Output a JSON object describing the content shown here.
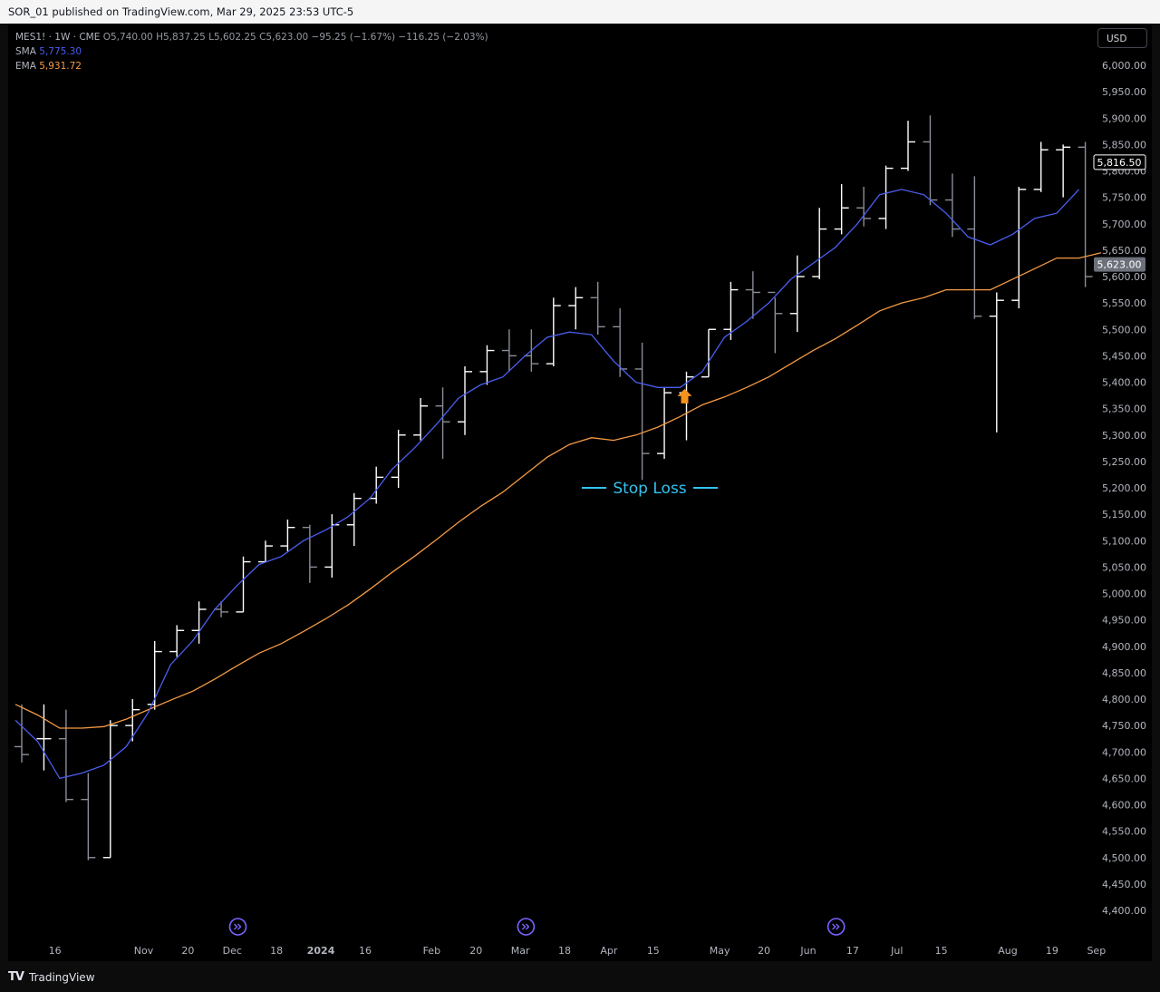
{
  "header": {
    "published_line": "SOR_01 published on TradingView.com, Mar 29, 2025 23:53 UTC-5"
  },
  "legend": {
    "symbol": "MES1! · 1W · CME",
    "ohlc": {
      "o": "O",
      "o_val": "5,740.00",
      "h": "H",
      "h_val": "5,837.25",
      "l": "L",
      "l_val": "5,602.25",
      "c": "C",
      "c_val": "5,623.00",
      "change": "−95.25 (−1.67%)",
      "change2": "−116.25 (−2.03%)"
    },
    "sma_label": "SMA",
    "sma_value": "5,775.30",
    "ema_label": "EMA",
    "ema_value": "5,931.72"
  },
  "currency_button": "USD",
  "annotation": {
    "text": "Stop Loss"
  },
  "footer": {
    "brand": "TradingView",
    "logo": "TV"
  },
  "colors": {
    "sma": "#4a5ef0",
    "ema": "#f59a45",
    "annotation": "#33c3ef",
    "arrow": "#f5931f",
    "event": "#7b61ff"
  },
  "chart_data": {
    "type": "ohlc-bar",
    "ylim": [
      4400,
      6000
    ],
    "y_ticks": [
      6000,
      5950,
      5900,
      5850,
      5800,
      5750,
      5700,
      5650,
      5600,
      5550,
      5500,
      5450,
      5400,
      5350,
      5300,
      5250,
      5200,
      5150,
      5100,
      5050,
      5000,
      4950,
      4900,
      4850,
      4800,
      4750,
      4700,
      4650,
      4600,
      4550,
      4500,
      4450,
      4400
    ],
    "y_tick_labels": [
      "6,000.00",
      "5,950.00",
      "5,900.00",
      "5,850.00",
      "5,800.00",
      "5,750.00",
      "5,700.00",
      "5,650.00",
      "5,600.00",
      "5,550.00",
      "5,500.00",
      "5,450.00",
      "5,400.00",
      "5,350.00",
      "5,300.00",
      "5,250.00",
      "5,200.00",
      "5,150.00",
      "5,100.00",
      "5,050.00",
      "5,000.00",
      "4,950.00",
      "4,900.00",
      "4,850.00",
      "4,800.00",
      "4,750.00",
      "4,700.00",
      "4,650.00",
      "4,600.00",
      "4,550.00",
      "4,500.00",
      "4,450.00",
      "4,400.00"
    ],
    "x_ticks": [
      {
        "bar": 1.5,
        "label": "16"
      },
      {
        "bar": 5.5,
        "label": "Nov"
      },
      {
        "bar": 7.5,
        "label": "20"
      },
      {
        "bar": 9.5,
        "label": "Dec"
      },
      {
        "bar": 11.5,
        "label": "18"
      },
      {
        "bar": 13.5,
        "label": "2024"
      },
      {
        "bar": 15.5,
        "label": "16"
      },
      {
        "bar": 18.5,
        "label": "Feb"
      },
      {
        "bar": 20.5,
        "label": "20"
      },
      {
        "bar": 22.5,
        "label": "Mar"
      },
      {
        "bar": 24.5,
        "label": "18"
      },
      {
        "bar": 26.5,
        "label": "Apr"
      },
      {
        "bar": 28.5,
        "label": "15"
      },
      {
        "bar": 31.5,
        "label": "May"
      },
      {
        "bar": 33.5,
        "label": "20"
      },
      {
        "bar": 35.5,
        "label": "Jun"
      },
      {
        "bar": 37.5,
        "label": "17"
      },
      {
        "bar": 39.5,
        "label": "Jul"
      },
      {
        "bar": 41.5,
        "label": "15"
      },
      {
        "bar": 44.5,
        "label": "Aug"
      },
      {
        "bar": 46.5,
        "label": "19"
      },
      {
        "bar": 48.5,
        "label": "Sep"
      }
    ],
    "bars": [
      {
        "o": 4710,
        "h": 4790,
        "l": 4680,
        "c": 4695
      },
      {
        "o": 4725,
        "h": 4790,
        "l": 4665,
        "c": 4725
      },
      {
        "o": 4725,
        "h": 4780,
        "l": 4605,
        "c": 4610
      },
      {
        "o": 4610,
        "h": 4660,
        "l": 4495,
        "c": 4500
      },
      {
        "o": 4500,
        "h": 4760,
        "l": 4500,
        "c": 4750
      },
      {
        "o": 4750,
        "h": 4800,
        "l": 4720,
        "c": 4780
      },
      {
        "o": 4790,
        "h": 4910,
        "l": 4780,
        "c": 4890
      },
      {
        "o": 4890,
        "h": 4940,
        "l": 4880,
        "c": 4930
      },
      {
        "o": 4930,
        "h": 4985,
        "l": 4905,
        "c": 4970
      },
      {
        "o": 4970,
        "h": 4985,
        "l": 4955,
        "c": 4965
      },
      {
        "o": 4965,
        "h": 5070,
        "l": 4965,
        "c": 5060
      },
      {
        "o": 5060,
        "h": 5100,
        "l": 5060,
        "c": 5090
      },
      {
        "o": 5090,
        "h": 5140,
        "l": 5080,
        "c": 5125
      },
      {
        "o": 5125,
        "h": 5130,
        "l": 5020,
        "c": 5050
      },
      {
        "o": 5050,
        "h": 5150,
        "l": 5030,
        "c": 5130
      },
      {
        "o": 5130,
        "h": 5190,
        "l": 5090,
        "c": 5180
      },
      {
        "o": 5180,
        "h": 5240,
        "l": 5170,
        "c": 5220
      },
      {
        "o": 5220,
        "h": 5310,
        "l": 5200,
        "c": 5300
      },
      {
        "o": 5300,
        "h": 5370,
        "l": 5290,
        "c": 5355
      },
      {
        "o": 5355,
        "h": 5390,
        "l": 5255,
        "c": 5325
      },
      {
        "o": 5325,
        "h": 5430,
        "l": 5300,
        "c": 5420
      },
      {
        "o": 5420,
        "h": 5470,
        "l": 5395,
        "c": 5460
      },
      {
        "o": 5460,
        "h": 5500,
        "l": 5420,
        "c": 5450
      },
      {
        "o": 5450,
        "h": 5500,
        "l": 5420,
        "c": 5435
      },
      {
        "o": 5435,
        "h": 5560,
        "l": 5430,
        "c": 5545
      },
      {
        "o": 5545,
        "h": 5580,
        "l": 5500,
        "c": 5560
      },
      {
        "o": 5560,
        "h": 5590,
        "l": 5490,
        "c": 5505
      },
      {
        "o": 5505,
        "h": 5540,
        "l": 5410,
        "c": 5425
      },
      {
        "o": 5425,
        "h": 5475,
        "l": 5215,
        "c": 5265
      },
      {
        "o": 5265,
        "h": 5390,
        "l": 5255,
        "c": 5380
      },
      {
        "o": 5380,
        "h": 5420,
        "l": 5290,
        "c": 5410
      },
      {
        "o": 5410,
        "h": 5500,
        "l": 5410,
        "c": 5500
      },
      {
        "o": 5500,
        "h": 5590,
        "l": 5480,
        "c": 5575
      },
      {
        "o": 5575,
        "h": 5610,
        "l": 5520,
        "c": 5570
      },
      {
        "o": 5570,
        "h": 5560,
        "l": 5455,
        "c": 5530
      },
      {
        "o": 5530,
        "h": 5640,
        "l": 5495,
        "c": 5600
      },
      {
        "o": 5600,
        "h": 5730,
        "l": 5595,
        "c": 5690
      },
      {
        "o": 5690,
        "h": 5775,
        "l": 5680,
        "c": 5730
      },
      {
        "o": 5730,
        "h": 5770,
        "l": 5695,
        "c": 5710
      },
      {
        "o": 5710,
        "h": 5810,
        "l": 5690,
        "c": 5805
      },
      {
        "o": 5805,
        "h": 5895,
        "l": 5800,
        "c": 5855
      },
      {
        "o": 5855,
        "h": 5905,
        "l": 5735,
        "c": 5745
      },
      {
        "o": 5745,
        "h": 5795,
        "l": 5675,
        "c": 5690
      },
      {
        "o": 5690,
        "h": 5790,
        "l": 5520,
        "c": 5525
      },
      {
        "o": 5525,
        "h": 5570,
        "l": 5305,
        "c": 5555
      },
      {
        "o": 5555,
        "h": 5770,
        "l": 5540,
        "c": 5765
      },
      {
        "o": 5765,
        "h": 5855,
        "l": 5760,
        "c": 5840
      },
      {
        "o": 5840,
        "h": 5850,
        "l": 5750,
        "c": 5845
      },
      {
        "o": 5845,
        "h": 5855,
        "l": 5580,
        "c": 5600
      }
    ],
    "sma": [
      4760,
      4720,
      4650,
      4660,
      4675,
      4710,
      4775,
      4865,
      4910,
      4970,
      5015,
      5055,
      5070,
      5100,
      5120,
      5145,
      5180,
      5235,
      5275,
      5320,
      5370,
      5395,
      5410,
      5450,
      5485,
      5495,
      5490,
      5440,
      5400,
      5390,
      5390,
      5420,
      5485,
      5515,
      5550,
      5595,
      5625,
      5655,
      5700,
      5755,
      5765,
      5755,
      5720,
      5675,
      5660,
      5680,
      5710,
      5720,
      5765
    ],
    "ema": [
      4790,
      4770,
      4745,
      4745,
      4748,
      4762,
      4780,
      4798,
      4815,
      4838,
      4863,
      4887,
      4905,
      4928,
      4952,
      4978,
      5008,
      5040,
      5070,
      5102,
      5135,
      5165,
      5192,
      5225,
      5258,
      5282,
      5295,
      5290,
      5300,
      5315,
      5335,
      5357,
      5372,
      5390,
      5410,
      5435,
      5460,
      5482,
      5508,
      5535,
      5550,
      5560,
      5575,
      5575,
      5575,
      5595,
      5615,
      5635,
      5635,
      5645
    ],
    "markers": [
      {
        "type": "price-label",
        "value": 5816.5,
        "label": "5,816.50",
        "style": "sma"
      },
      {
        "type": "price-label",
        "value": 5623.0,
        "label": "5,623.00",
        "style": "last"
      }
    ],
    "events": [
      10,
      23,
      37
    ],
    "arrow_bar": 30,
    "arrow_value": 5365
  }
}
